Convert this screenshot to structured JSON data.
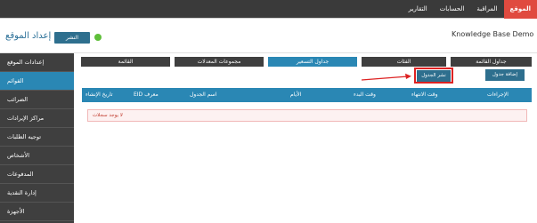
{
  "topnav": {
    "items": [
      {
        "label": "الموقع",
        "active": true
      },
      {
        "label": "المراقبة",
        "active": false
      },
      {
        "label": "الحسابات",
        "active": false
      },
      {
        "label": "التقارير",
        "active": false
      }
    ]
  },
  "header": {
    "app_title": "Knowledge Base Demo",
    "page_title": "إعداد الموقع",
    "publish_label": "النشر",
    "status": "online"
  },
  "sidebar": {
    "items": [
      {
        "label": "إعدادات الموقع",
        "active": false
      },
      {
        "label": "القوائم",
        "active": true
      },
      {
        "label": "الضرائب",
        "active": false
      },
      {
        "label": "مراكز الإيرادات",
        "active": false
      },
      {
        "label": "توجيه الطلبات",
        "active": false
      },
      {
        "label": "الأشخاص",
        "active": false
      },
      {
        "label": "المدفوعات",
        "active": false
      },
      {
        "label": "إدارة النقدية",
        "active": false
      },
      {
        "label": "الأجهزة",
        "active": false
      }
    ]
  },
  "tabs": [
    {
      "label": "جداول القائمة",
      "active": false
    },
    {
      "label": "الفئات",
      "active": false
    },
    {
      "label": "جداول التسعير",
      "active": true
    },
    {
      "label": "مجموعات المعدلات",
      "active": false
    },
    {
      "label": "القائمة",
      "active": false
    }
  ],
  "actions": {
    "add_label": "إضافة جدول",
    "publish_schedule_label": "نشر الجدول"
  },
  "table": {
    "columns": [
      "الإجراءات",
      "وقت الانتهاء",
      "وقت البدء",
      "الأيام",
      "اسم الجدول",
      "EID معرف",
      "تاريخ الإنشاء"
    ],
    "empty_message": "لا يوجد سجلات"
  },
  "colors": {
    "accent": "#2a87b4",
    "nav_active": "#e04a3f",
    "highlight": "#dd2222",
    "status_dot": "#5fbf3a"
  }
}
